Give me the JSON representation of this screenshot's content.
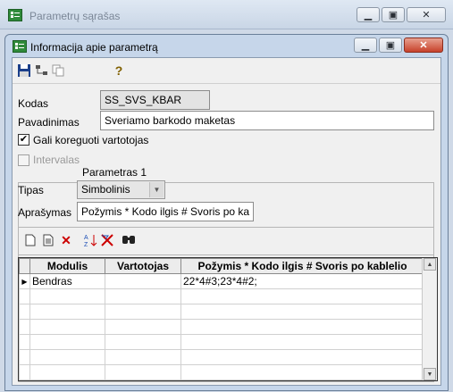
{
  "background_window": {
    "title": "Parametrų sąrašas"
  },
  "dialog": {
    "title": "Informacija apie parametrą",
    "toolbar": {
      "save": "save-icon",
      "tree": "tree-icon",
      "copy": "copy-icon",
      "help": "?"
    }
  },
  "form": {
    "kodas_label": "Kodas",
    "kodas_value": "SS_SVS_KBAR",
    "pavadinimas_label": "Pavadinimas",
    "pavadinimas_value": "Sveriamo barkodo maketas",
    "editable_label": "Gali koreguoti vartotojas",
    "editable_checked": true,
    "intervalas_label": "Intervalas",
    "intervalas_checked": false,
    "param_header": "Parametras 1",
    "tipas_label": "Tipas",
    "tipas_value": "Simbolinis",
    "aprasymas_label": "Aprašymas",
    "aprasymas_value": "Požymis * Kodo ilgis # Svoris po ka"
  },
  "grid": {
    "toolbar": [
      "new-icon",
      "edit-icon",
      "delete-icon",
      "sort-icon",
      "filter-clear-icon",
      "find-icon"
    ],
    "columns": [
      "Modulis",
      "Vartotojas",
      "Požymis * Kodo ilgis # Svoris po kablelio"
    ],
    "rows": [
      [
        "Bendras",
        "",
        "22*4#3;23*4#2;"
      ]
    ],
    "current_row_marker": "▶"
  },
  "colors": {
    "accent": "#c6d6ea",
    "close": "#c7412a"
  }
}
